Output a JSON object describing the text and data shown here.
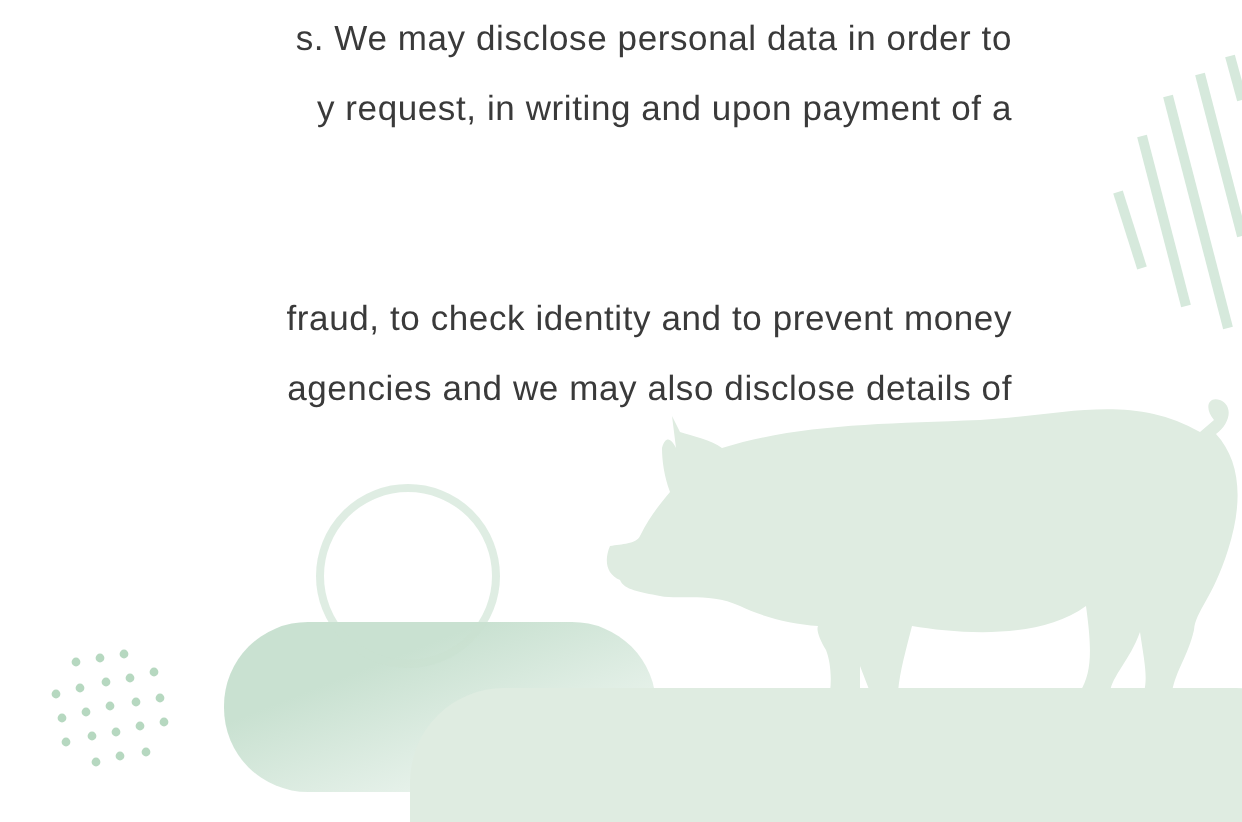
{
  "paragraphs": [
    {
      "lines": [
        "s. We may disclose personal data in order to",
        "y request, in writing and upon payment of a"
      ]
    },
    {
      "lines": [
        "fraud, to check identity and to prevent money",
        "agencies and we may also disclose details of"
      ]
    }
  ]
}
